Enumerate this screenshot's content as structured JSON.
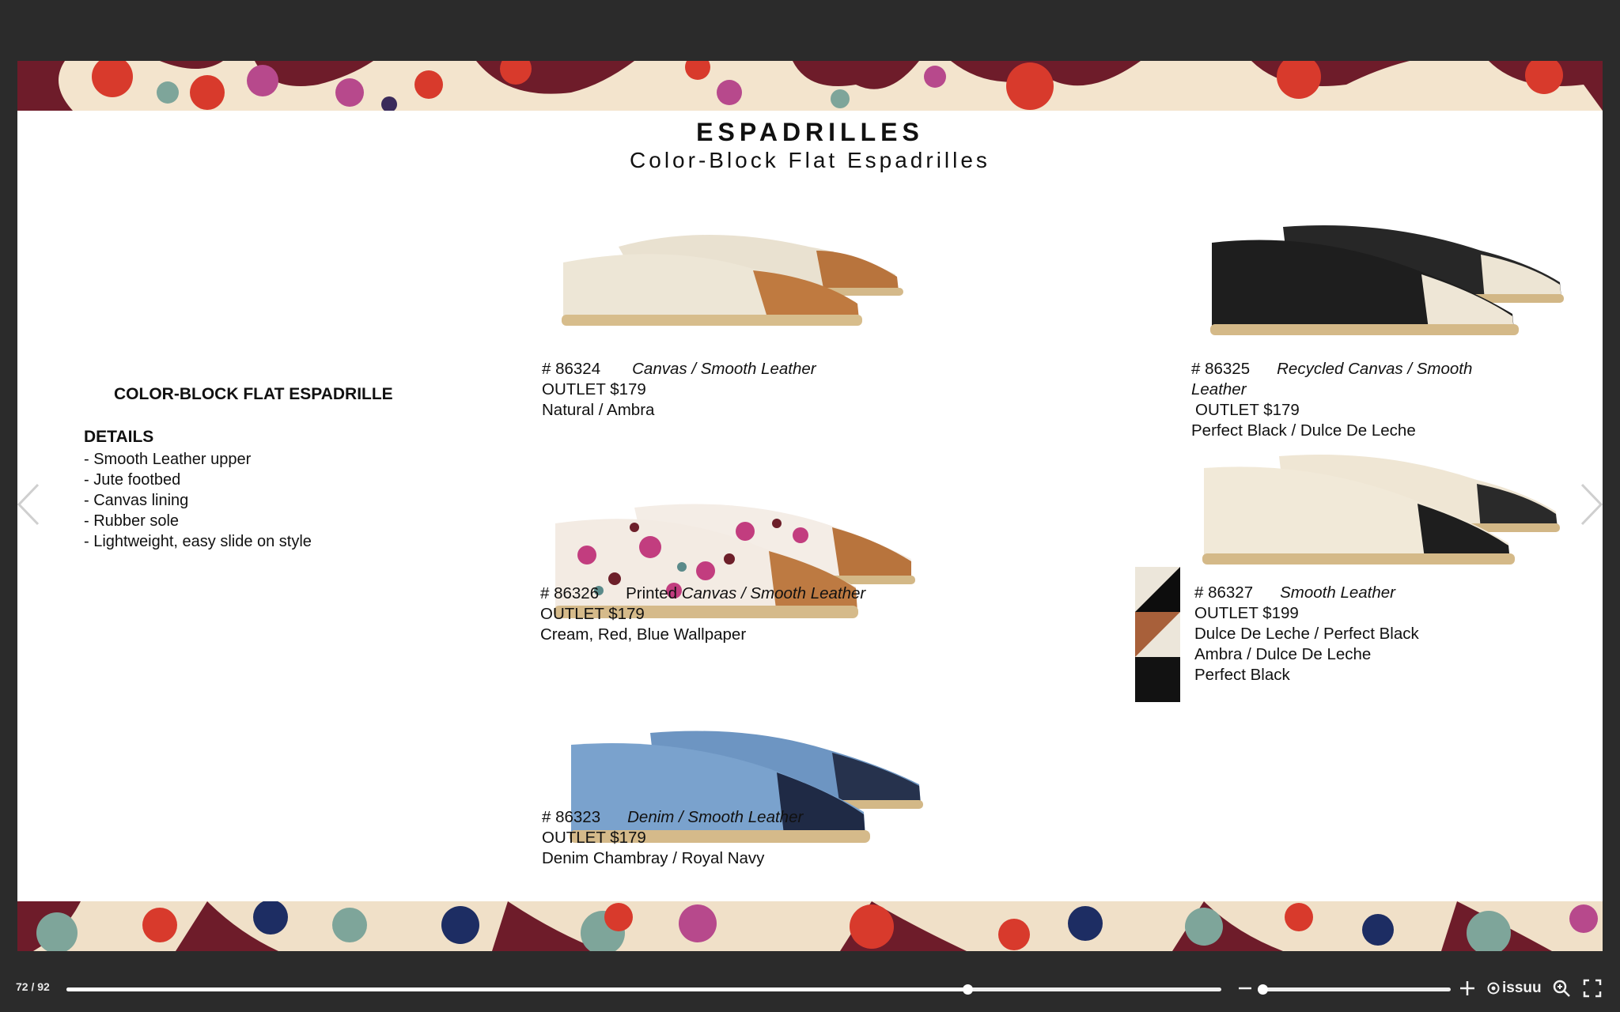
{
  "header": {
    "title": "ESPADRILLES",
    "subtitle": "Color-Block Flat Espadrilles"
  },
  "product": {
    "name": "COLOR-BLOCK FLAT ESPADRILLE",
    "details_heading": "DETAILS",
    "details": [
      "- Smooth Leather upper",
      "- Jute footbed",
      "- Canvas lining",
      "- Rubber sole",
      "- Lightweight, easy slide on style"
    ]
  },
  "items": [
    {
      "code": "# 86324",
      "material": "Canvas / Smooth Leather",
      "price": "OUTLET $179",
      "colors": [
        "Natural / Ambra"
      ]
    },
    {
      "code": "# 86326",
      "material_prefix": "Printed",
      "material": "Canvas / Smooth Leather",
      "price": "OUTLET $179",
      "colors": [
        "Cream, Red, Blue Wallpaper"
      ]
    },
    {
      "code": "# 86323",
      "material": "Denim / Smooth Leather",
      "price": "OUTLET $179",
      "colors": [
        "Denim Chambray / Royal Navy"
      ]
    },
    {
      "code": "# 86325",
      "material_line1": "Recycled Canvas / Smooth",
      "material_line2": "Leather",
      "price": "OUTLET $179",
      "colors": [
        "Perfect Black / Dulce De Leche"
      ]
    },
    {
      "code": "# 86327",
      "material": "Smooth Leather",
      "price": "OUTLET $199",
      "colors": [
        "Dulce De Leche / Perfect Black",
        "Ambra / Dulce De Leche",
        "Perfect Black"
      ]
    }
  ],
  "viewer": {
    "page_indicator": "72 / 92",
    "progress_fraction": 0.78,
    "zoom_fraction": 0.0,
    "brand": "issuu"
  },
  "icons": {
    "prev": "chevron-left-icon",
    "next": "chevron-right-icon",
    "zoom_out": "minus-icon",
    "zoom_in": "plus-icon",
    "zoom": "magnify-icon",
    "fullscreen": "fullscreen-icon"
  }
}
